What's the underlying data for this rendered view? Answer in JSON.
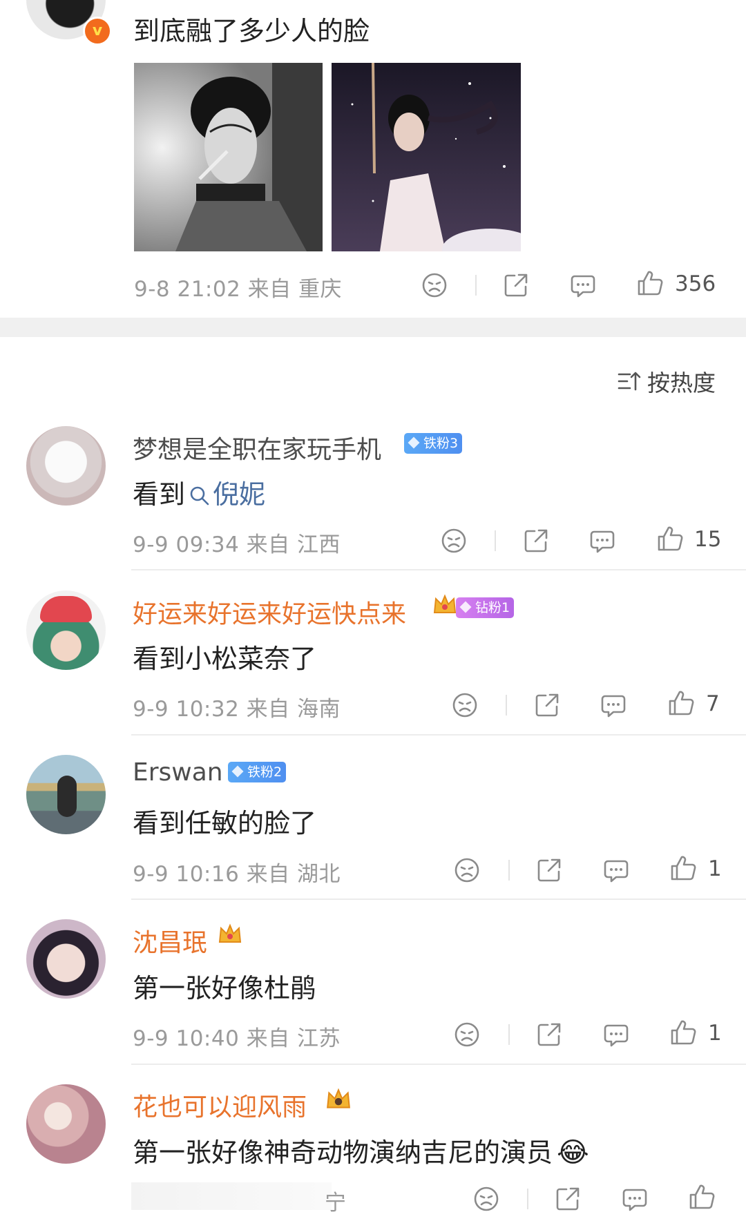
{
  "post": {
    "text": "到底融了多少人的脸",
    "meta": "9-8 21:02  来自 重庆",
    "likes": "356"
  },
  "sort": {
    "label": "按热度"
  },
  "search_tag": "倪妮",
  "comments": [
    {
      "user": "梦想是全职在家玩手机",
      "badge": "铁粉3",
      "text": "看到",
      "meta": "9-9 09:34  来自 江西",
      "likes": "15"
    },
    {
      "user": "好运来好运来好运快点来",
      "badge": "钻粉1",
      "text": "看到小松菜奈了",
      "meta": "9-9 10:32  来自 海南",
      "likes": "7"
    },
    {
      "user": "Erswan",
      "badge": "铁粉2",
      "text": "看到任敏的脸了",
      "meta": "9-9 10:16  来自 湖北",
      "likes": "1"
    },
    {
      "user": "沈昌珉",
      "text": "第一张好像杜鹃",
      "meta": "9-9 10:40  来自 江苏",
      "likes": "1"
    },
    {
      "user": "花也可以迎风雨",
      "text": "第一张好像神奇动物演纳吉尼的演员",
      "meta": "宁",
      "emoji": "😂"
    }
  ],
  "icons": {
    "dislike": "sad-face-icon",
    "share": "share-icon",
    "comment": "comment-icon",
    "like": "thumbs-up-icon",
    "verified": "verified-v-icon",
    "sort": "sort-icon",
    "search": "search-icon"
  },
  "colors": {
    "gold_name": "#e8732c",
    "link": "#4a6ea0",
    "meta": "#9a9a9a",
    "verified": "#f26b1d"
  }
}
